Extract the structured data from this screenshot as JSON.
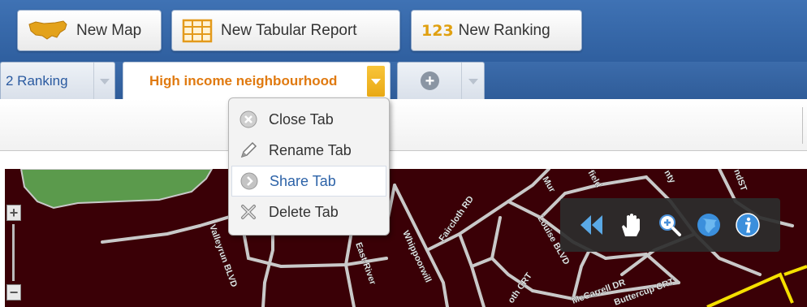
{
  "toolbar": {
    "new_map": {
      "label": "New Map",
      "icon": "usa-map-icon"
    },
    "new_tabular_report": {
      "label": "New Tabular Report",
      "icon": "table-grid-icon"
    },
    "new_ranking": {
      "label": "New Ranking",
      "icon_text": "123",
      "icon": "ranking-123-icon"
    }
  },
  "tabs": [
    {
      "label": "2 Ranking",
      "state": "inactive"
    },
    {
      "label": "High income neighbourhood",
      "state": "active"
    },
    {
      "label": "",
      "icon": "plus-icon",
      "state": "add-tab"
    }
  ],
  "tab_menu": {
    "items": [
      {
        "label": "Close Tab",
        "icon": "close-circle-icon"
      },
      {
        "label": "Rename Tab",
        "icon": "pencil-icon"
      },
      {
        "label": "Share Tab",
        "icon": "share-arrow-icon",
        "highlighted": true
      },
      {
        "label": "Delete Tab",
        "icon": "delete-x-icon"
      }
    ]
  },
  "map": {
    "zoom_in": "+",
    "zoom_out": "−",
    "street_labels": [
      "Faircloth RD",
      "Valleyrun BLVD",
      "East-River",
      "Whippoorwill",
      "Louise BLVD",
      "McCarrell DR",
      "Buttercup CRT",
      "oth CRT",
      "Mur",
      "field",
      "nty",
      "ndST"
    ],
    "tools": [
      {
        "name": "rewind",
        "icon": "double-arrow-left-icon"
      },
      {
        "name": "pan",
        "icon": "hand-icon"
      },
      {
        "name": "zoom",
        "icon": "magnifier-plus-icon"
      },
      {
        "name": "globe",
        "icon": "globe-icon"
      },
      {
        "name": "info",
        "icon": "info-icon"
      }
    ]
  },
  "colors": {
    "header_blue": "#3a6aaa",
    "active_tab_text": "#e07a10",
    "map_background": "#3a0006",
    "menu_highlight_text": "#2d63a8"
  }
}
